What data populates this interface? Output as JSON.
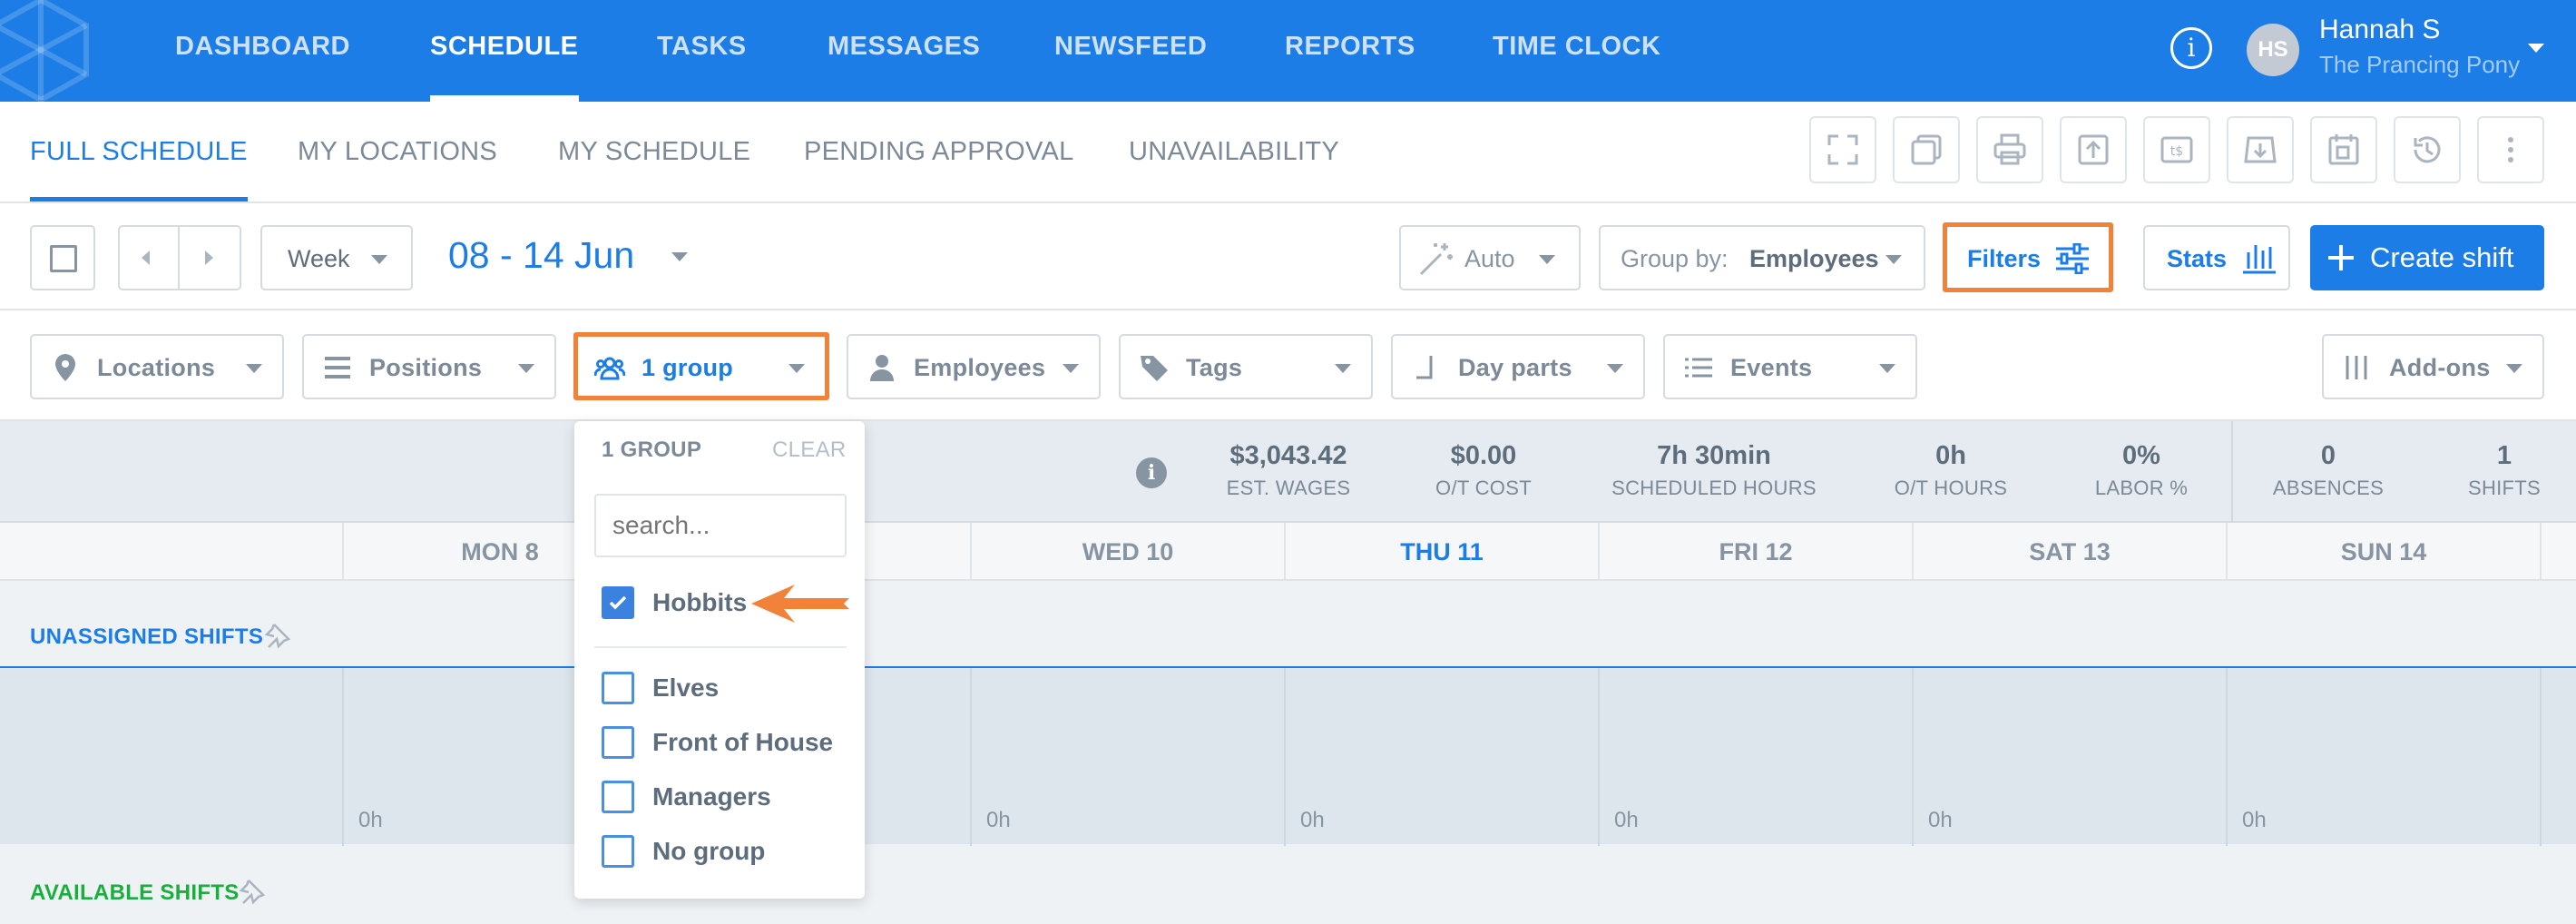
{
  "colors": {
    "brand": "#1c7de6",
    "accent": "#f0823a",
    "available": "#1aaf3c"
  },
  "topnav": {
    "items": [
      {
        "label": "DASHBOARD",
        "active": false
      },
      {
        "label": "SCHEDULE",
        "active": true
      },
      {
        "label": "TASKS",
        "active": false
      },
      {
        "label": "MESSAGES",
        "active": false
      },
      {
        "label": "NEWSFEED",
        "active": false
      },
      {
        "label": "REPORTS",
        "active": false
      },
      {
        "label": "TIME CLOCK",
        "active": false
      }
    ],
    "user": {
      "initials": "HS",
      "name": "Hannah S",
      "location": "The Prancing Pony"
    }
  },
  "subnav": {
    "items": [
      {
        "label": "FULL SCHEDULE",
        "active": true
      },
      {
        "label": "MY LOCATIONS",
        "active": false
      },
      {
        "label": "MY SCHEDULE",
        "active": false
      },
      {
        "label": "PENDING APPROVAL",
        "active": false
      },
      {
        "label": "UNAVAILABILITY",
        "active": false
      }
    ],
    "tools": [
      "expand-icon",
      "copy-icon",
      "print-icon",
      "upload-icon",
      "wages-icon",
      "inbox-download-icon",
      "calendar-copy-icon",
      "history-icon",
      "more-icon"
    ]
  },
  "toolbar": {
    "view": "Week",
    "date_range": "08 - 14 Jun",
    "auto": "Auto",
    "group_by_label": "Group by:",
    "group_by_value": "Employees",
    "filters": "Filters",
    "stats": "Stats",
    "create": "Create shift"
  },
  "filters": {
    "locations": "Locations",
    "positions": "Positions",
    "group": "1 group",
    "employees": "Employees",
    "tags": "Tags",
    "day_parts": "Day parts",
    "events": "Events",
    "addons": "Add-ons"
  },
  "stats": [
    {
      "value": "$3,043.42",
      "label": "EST. WAGES"
    },
    {
      "value": "$0.00",
      "label": "O/T COST"
    },
    {
      "value": "7h 30min",
      "label": "SCHEDULED HOURS"
    },
    {
      "value": "0h",
      "label": "O/T HOURS"
    },
    {
      "value": "0%",
      "label": "LABOR %"
    },
    {
      "value": "0",
      "label": "ABSENCES"
    },
    {
      "value": "1",
      "label": "SHIFTS"
    }
  ],
  "days": [
    {
      "label": "MON 8",
      "today": false
    },
    {
      "label": "",
      "today": false
    },
    {
      "label": "WED 10",
      "today": false
    },
    {
      "label": "THU 11",
      "today": true
    },
    {
      "label": "FRI 12",
      "today": false
    },
    {
      "label": "SAT 13",
      "today": false
    },
    {
      "label": "SUN 14",
      "today": false
    }
  ],
  "sections": {
    "unassigned": "UNASSIGNED SHIFTS",
    "available": "AVAILABLE SHIFTS"
  },
  "unassigned_hours": [
    "0h",
    "",
    "0h",
    "0h",
    "0h",
    "0h",
    "0h"
  ],
  "group_dropdown": {
    "title": "1 GROUP",
    "clear": "CLEAR",
    "search_placeholder": "search...",
    "options": [
      {
        "label": "Hobbits",
        "checked": true
      },
      {
        "label": "Elves",
        "checked": false
      },
      {
        "label": "Front of House",
        "checked": false
      },
      {
        "label": "Managers",
        "checked": false
      },
      {
        "label": "No group",
        "checked": false
      }
    ]
  }
}
